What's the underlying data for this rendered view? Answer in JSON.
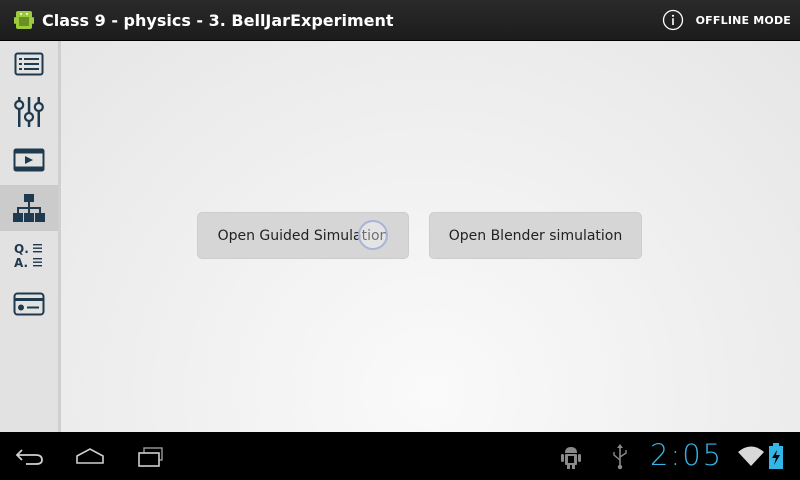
{
  "action_bar": {
    "title": "Class 9 - physics - 3. BellJarExperiment",
    "offline_label": "OFFLINE MODE",
    "app_icon": "android-icon",
    "info_icon": "info-icon"
  },
  "sidebar": {
    "items": [
      {
        "icon": "list-icon",
        "active": false
      },
      {
        "icon": "sliders-icon",
        "active": false
      },
      {
        "icon": "video-icon",
        "active": false
      },
      {
        "icon": "hierarchy-icon",
        "active": true
      },
      {
        "icon": "qa-icon",
        "active": false
      },
      {
        "icon": "card-icon",
        "active": false
      }
    ],
    "qa_q": "Q.",
    "qa_a": "A."
  },
  "main": {
    "buttons": [
      {
        "label": "Open Guided Simulation"
      },
      {
        "label": "Open Blender simulation"
      }
    ]
  },
  "system_bar": {
    "time": "2:05",
    "icons": [
      "back-icon",
      "home-icon",
      "recents-icon",
      "android-debug-icon",
      "usb-icon",
      "wifi-icon",
      "battery-icon"
    ]
  },
  "colors": {
    "clock": "#33b5e5",
    "sidebar_icon": "#1f3a4f"
  }
}
